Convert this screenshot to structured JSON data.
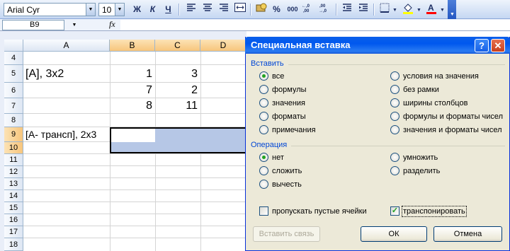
{
  "toolbar": {
    "font_name": "Arial Cyr",
    "font_size": "10",
    "bold": "Ж",
    "italic": "К",
    "underline": "Ч",
    "percent": "%",
    "thousands": "000",
    "fill_color": "#ffff00",
    "font_color": "#ff0000"
  },
  "formula_bar": {
    "name_box": "B9",
    "fx_symbol": "fx",
    "content": ""
  },
  "sheet": {
    "columns": [
      "A",
      "B",
      "C",
      "D"
    ],
    "rows": [
      "4",
      "5",
      "6",
      "7",
      "8",
      "9",
      "10",
      "11",
      "12",
      "13",
      "14",
      "15",
      "16",
      "17",
      "18"
    ],
    "cells": {
      "A5": "[A], 3x2",
      "B5": "1",
      "C5": "3",
      "B6": "7",
      "C6": "2",
      "B7": "8",
      "C7": "11",
      "A9": "[A- трансп], 2x3"
    },
    "active_cell": "B9",
    "selection_color": "#b6c7e6"
  },
  "dialog": {
    "title": "Специальная вставка",
    "help_button": "?",
    "close_button": "✕",
    "paste_group_label": "Вставить",
    "paste_options": [
      {
        "label": "все",
        "selected": true
      },
      {
        "label": "формулы",
        "selected": false
      },
      {
        "label": "значения",
        "selected": false
      },
      {
        "label": "форматы",
        "selected": false
      },
      {
        "label": "примечания",
        "selected": false
      },
      {
        "label": "условия на значения",
        "selected": false
      },
      {
        "label": "без рамки",
        "selected": false
      },
      {
        "label": "ширины столбцов",
        "selected": false
      },
      {
        "label": "формулы и форматы чисел",
        "selected": false
      },
      {
        "label": "значения и форматы чисел",
        "selected": false
      }
    ],
    "operation_group_label": "Операция",
    "operation_options": [
      {
        "label": "нет",
        "selected": true
      },
      {
        "label": "сложить",
        "selected": false
      },
      {
        "label": "вычесть",
        "selected": false
      },
      {
        "label": "умножить",
        "selected": false
      },
      {
        "label": "разделить",
        "selected": false
      }
    ],
    "skip_blanks": {
      "label": "пропускать пустые ячейки",
      "checked": false
    },
    "transpose": {
      "label": "транспонировать",
      "checked": true,
      "check_mark": "✓"
    },
    "paste_link_button": "Вставить связь",
    "ok_button": "ОК",
    "cancel_button": "Отмена"
  }
}
